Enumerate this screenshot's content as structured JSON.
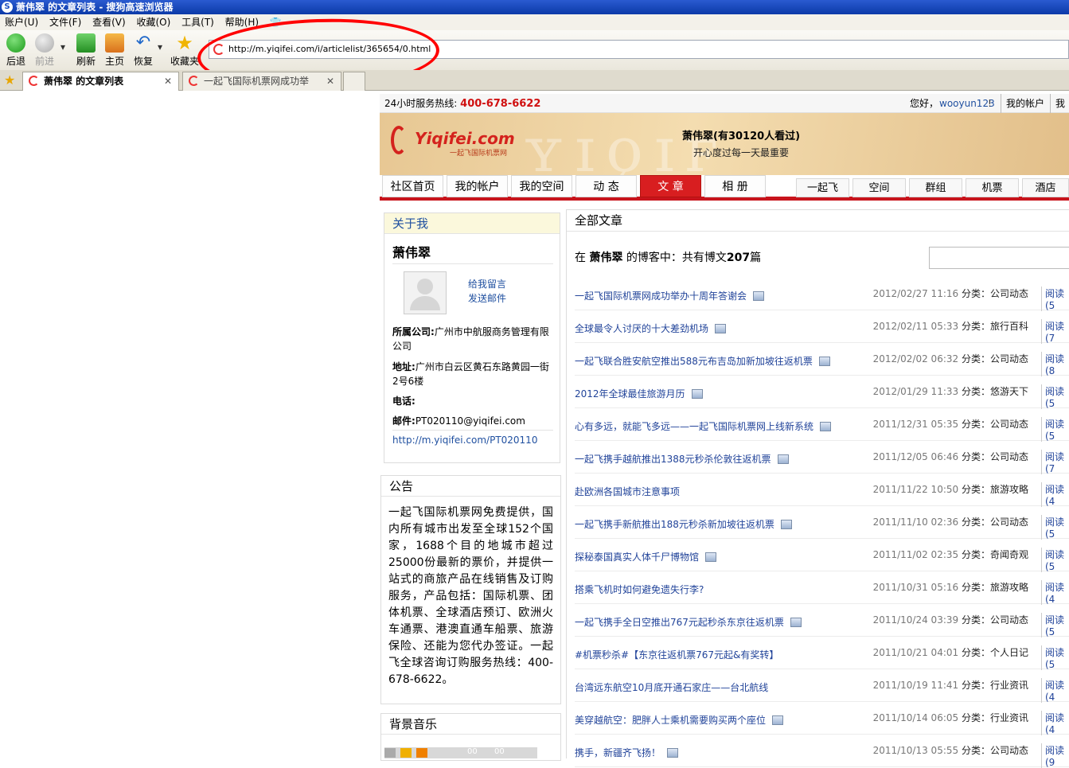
{
  "window": {
    "title": "萧伟翠 的文章列表 - 搜狗高速浏览器"
  },
  "menu": [
    "账户(U)",
    "文件(F)",
    "查看(V)",
    "收藏(O)",
    "工具(T)",
    "帮助(H)"
  ],
  "toolbar": {
    "back": "后退",
    "forward": "前进",
    "refresh": "刷新",
    "home": "主页",
    "restore": "恢复",
    "favorites": "收藏夹"
  },
  "address": {
    "url": "http://m.yiqifei.com/i/articlelist/365654/0.html"
  },
  "tabs": [
    {
      "label": "萧伟翠 的文章列表"
    },
    {
      "label": "一起飞国际机票网成功举"
    }
  ],
  "site": {
    "hotline_label": "24小时服务热线:",
    "hotline": "400-678-6622",
    "greeting": "您好，",
    "username": "wooyun123",
    "account_link": "我的帐户",
    "account_link2": "我的",
    "logo_text": "Yiqifei.com",
    "logo_sub": "一起飞国际机票网",
    "blog_name": "萧伟翠(有30120人看过)",
    "motto": "开心度过每一天最重要",
    "nav_main": [
      "社区首页",
      "我的帐户",
      "我的空间",
      "动 态",
      "文 章",
      "相 册"
    ],
    "nav_side": [
      "一起飞",
      "空间",
      "群组",
      "机票",
      "酒店"
    ]
  },
  "about": {
    "title": "关于我",
    "name": "萧伟翠",
    "leave_msg": "给我留言",
    "send_mail": "发送邮件",
    "company_label": "所属公司:",
    "company": "广州市中航服商务管理有限公司",
    "address_label": "地址:",
    "address": "广州市白云区黄石东路黄园一街2号6楼",
    "phone_label": "电话:",
    "mail_label": "邮件:",
    "mail": "PT020110@yiqifei.com",
    "link": "http://m.yiqifei.com/PT020110"
  },
  "notice": {
    "title": "公告",
    "text": "一起飞国际机票网免费提供，国内所有城市出发至全球152个国家，1688个目的地城市超过25000份最新的票价，并提供一站式的商旅产品在线销售及订购服务，产品包括：国际机票、团体机票、全球酒店预订、欧洲火车通票、港澳直通车船票、旅游保险、还能为您代办签证。一起飞全球咨询订购服务热线：400-678-6622。"
  },
  "music": {
    "title": "背景音乐",
    "time1": "00",
    "time2": "00"
  },
  "articles_panel": {
    "title": "全部文章",
    "summary_pre": "在 ",
    "summary_name": "萧伟翠",
    "summary_mid": " 的博客中：共有博文",
    "summary_count": "207",
    "summary_post": "篇"
  },
  "article_category_label": "分类：",
  "articles": [
    {
      "title": "一起飞国际机票网成功举办十周年答谢会",
      "date": "2012/02/27 11:16",
      "cat": "公司动态",
      "read": "阅读(5"
    },
    {
      "title": "全球最令人讨厌的十大差劲机场",
      "date": "2012/02/11 05:33",
      "cat": "旅行百科",
      "read": "阅读(7"
    },
    {
      "title": "一起飞联合胜安航空推出588元布吉岛加新加坡往返机票",
      "date": "2012/02/02 06:32",
      "cat": "公司动态",
      "read": "阅读(8"
    },
    {
      "title": "2012年全球最佳旅游月历",
      "date": "2012/01/29 11:33",
      "cat": "悠游天下",
      "read": "阅读(5"
    },
    {
      "title": "心有多远，就能飞多远——一起飞国际机票网上线新系统",
      "date": "2011/12/31 05:35",
      "cat": "公司动态",
      "read": "阅读(5"
    },
    {
      "title": "一起飞携手越航推出1388元秒杀伦敦往返机票",
      "date": "2011/12/05 06:46",
      "cat": "公司动态",
      "read": "阅读(7"
    },
    {
      "title": "赴欧洲各国城市注意事项",
      "date": "2011/11/22 10:50",
      "cat": "旅游攻略",
      "read": "阅读(4"
    },
    {
      "title": "一起飞携手新航推出188元秒杀新加坡往返机票",
      "date": "2011/11/10 02:36",
      "cat": "公司动态",
      "read": "阅读(5"
    },
    {
      "title": "探秘泰国真实人体千尸博物馆",
      "date": "2011/11/02 02:35",
      "cat": "奇闻奇观",
      "read": "阅读(5"
    },
    {
      "title": "搭乘飞机时如何避免遗失行李?",
      "date": "2011/10/31 05:16",
      "cat": "旅游攻略",
      "read": "阅读(4"
    },
    {
      "title": "一起飞携手全日空推出767元起秒杀东京往返机票",
      "date": "2011/10/24 03:39",
      "cat": "公司动态",
      "read": "阅读(5"
    },
    {
      "title": "#机票秒杀#【东京往返机票767元起&有奖转】",
      "date": "2011/10/21 04:01",
      "cat": "个人日记",
      "read": "阅读(5"
    },
    {
      "title": "台湾远东航空10月底开通石家庄——台北航线",
      "date": "2011/10/19 11:41",
      "cat": "行业资讯",
      "read": "阅读(4"
    },
    {
      "title": "美穿越航空：肥胖人士乘机需要购买两个座位",
      "date": "2011/10/14 06:05",
      "cat": "行业资讯",
      "read": "阅读(4"
    },
    {
      "title": "携手，新疆齐飞扬！",
      "date": "2011/10/13 05:55",
      "cat": "公司动态",
      "read": "阅读(9"
    }
  ]
}
